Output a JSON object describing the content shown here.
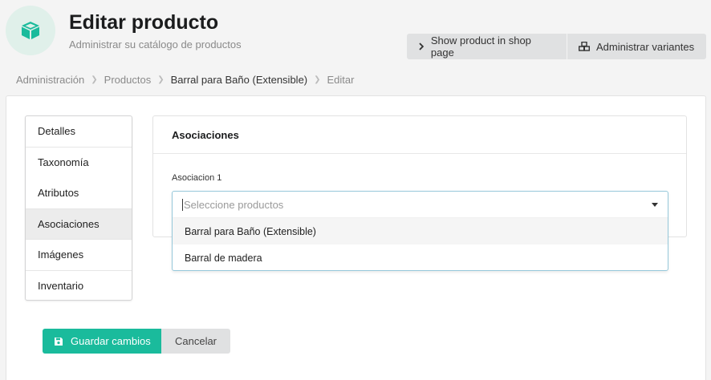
{
  "header": {
    "title": "Editar producto",
    "subtitle": "Administrar su catálogo de productos",
    "icon": "cube-icon",
    "accent_color": "#1abb9c",
    "buttons": {
      "show_product": "Show product in shop page",
      "manage_variants": "Administrar variantes"
    }
  },
  "breadcrumb": [
    "Administración",
    "Productos",
    "Barral para Baño (Extensible)",
    "Editar"
  ],
  "sidebar": {
    "items": [
      {
        "label": "Detalles"
      },
      {
        "label": "Taxonomía"
      },
      {
        "label": "Atributos"
      },
      {
        "label": "Asociaciones"
      },
      {
        "label": "Imágenes"
      },
      {
        "label": "Inventario"
      }
    ],
    "active": "Asociaciones"
  },
  "associations": {
    "title": "Asociaciones",
    "field_label": "Asociacion 1",
    "select": {
      "placeholder": "Seleccione productos",
      "options": [
        "Barral para Baño (Extensible)",
        "Barral de madera"
      ]
    }
  },
  "actions": {
    "save": "Guardar cambios",
    "cancel": "Cancelar"
  }
}
